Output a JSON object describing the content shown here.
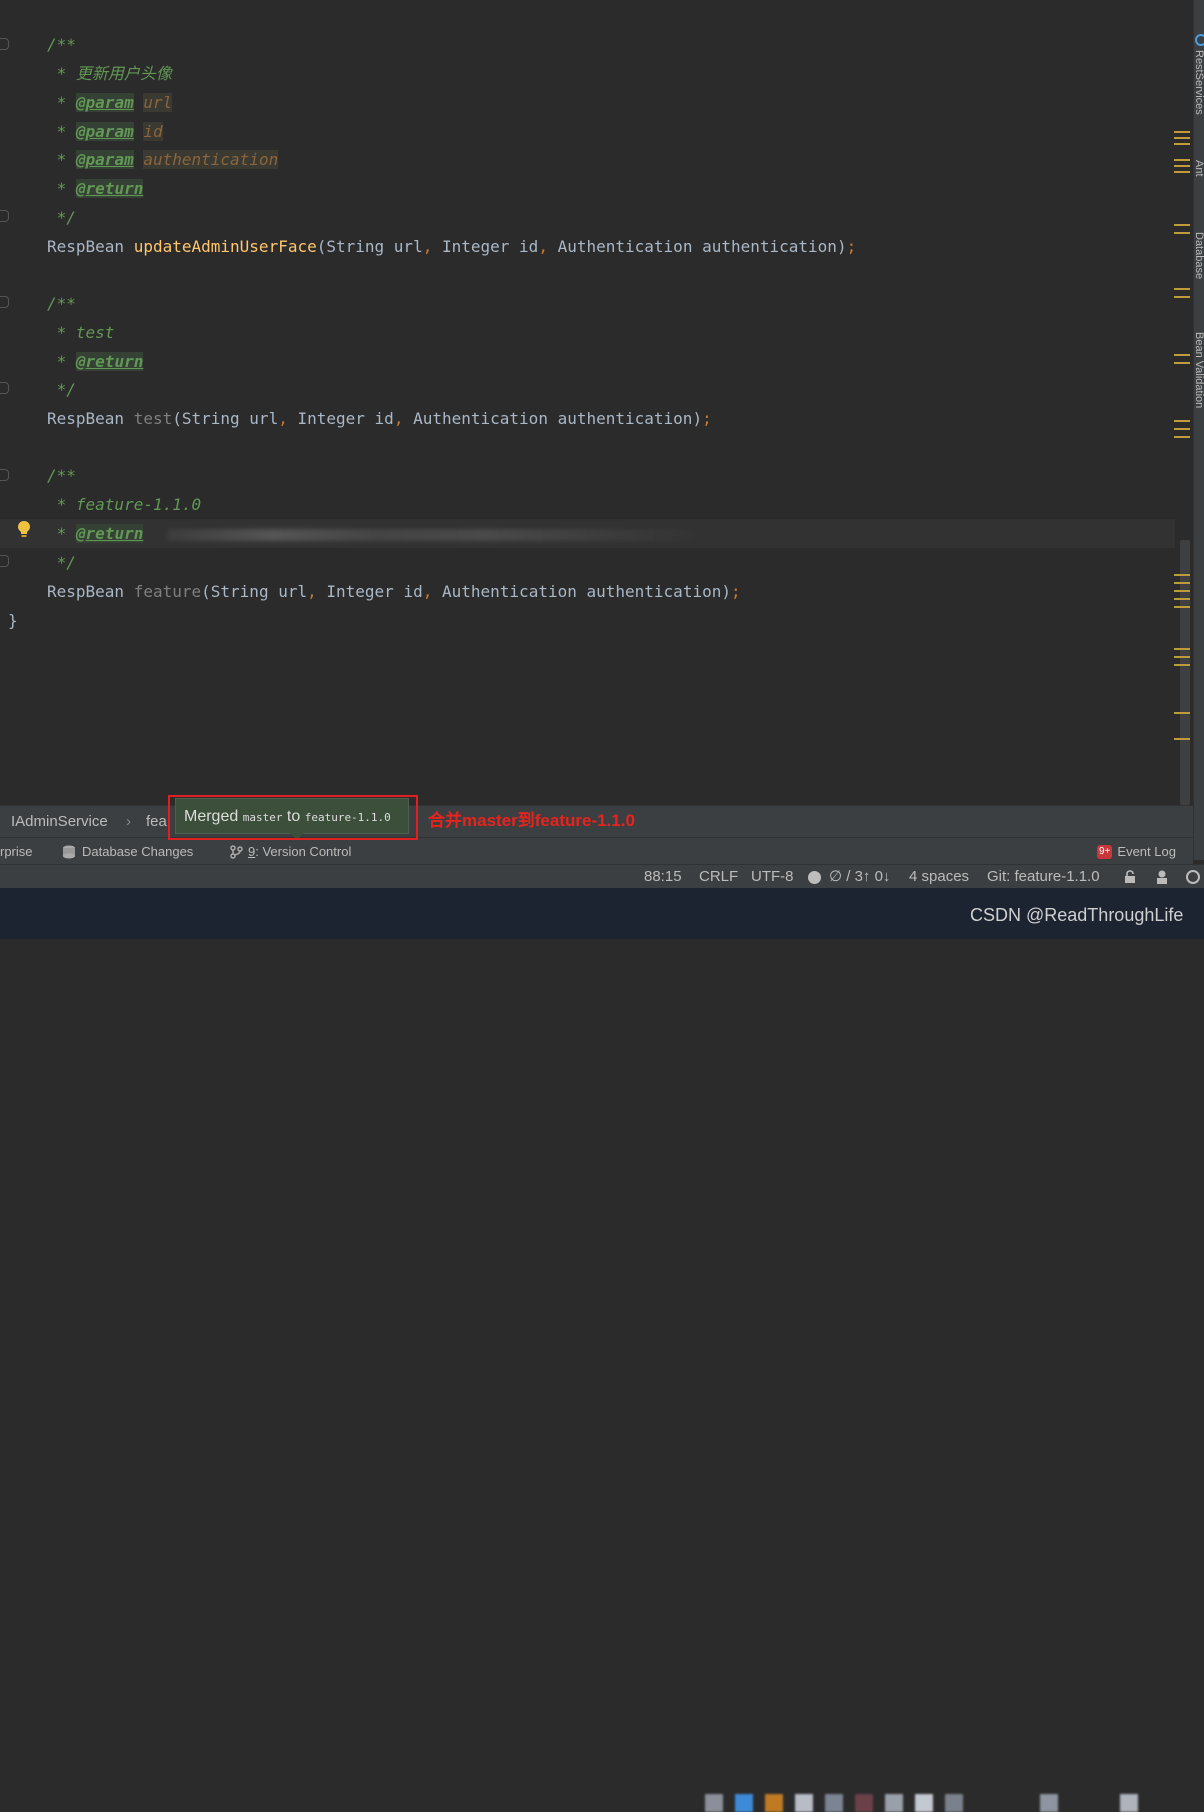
{
  "editor": {
    "doc1": {
      "open": "/**",
      "desc": " * 更新用户头像",
      "param_tag": "@param",
      "p1": "url",
      "p2": "id",
      "p3": "authentication",
      "return_tag": "@return",
      "close": " */"
    },
    "method1": {
      "ret": "RespBean ",
      "name": "updateAdminUserFace",
      "args_a": "(String url",
      "args_b": " Integer id",
      "args_c": " Authentication authentication)",
      "semi": ";"
    },
    "doc2": {
      "open": "/**",
      "desc": " * test",
      "return_tag": "@return",
      "close": " */"
    },
    "method2": {
      "ret": "RespBean ",
      "name": "test",
      "args_a": "(String url",
      "args_b": " Integer id",
      "args_c": " Authentication authentication)",
      "semi": ";"
    },
    "doc3": {
      "open": "/**",
      "desc": " * feature-1.1.0",
      "return_tag": "@return",
      "close": " */"
    },
    "method3": {
      "ret": "RespBean ",
      "name": "feature",
      "args_a": "(String url",
      "args_b": " Integer id",
      "args_c": " Authentication authentication)",
      "semi": ";"
    },
    "closing_brace": "}",
    "comma": ",",
    "star": " * "
  },
  "breadcrumbs": {
    "item1": "IAdminService",
    "item2": "fea"
  },
  "popup": {
    "merged": "Merged",
    "source_branch": "master",
    "to": "to",
    "target_branch": "feature-1.1.0"
  },
  "annotation": "合并master到feature-1.1.0",
  "tool_windows": {
    "partial": "rprise",
    "database_changes": "Database Changes",
    "version_control_num": "9",
    "version_control": ": Version Control",
    "event_log_badge": "9+",
    "event_log": "Event Log"
  },
  "status_bar": {
    "position": "88:15",
    "line_sep": "CRLF",
    "encoding": "UTF-8",
    "vcs_counts": "∅ / 3↑ 0↓",
    "indent": "4 spaces",
    "git_branch": "Git: feature-1.1.0"
  },
  "right_tabs": [
    "RestServices",
    "Ant",
    "Database",
    "Bean Validation"
  ],
  "watermark": "CSDN @ReadThroughLife",
  "colors": {
    "editor_bg": "#2b2b2b",
    "doc_comment": "#629755",
    "keyword_orange": "#cc7832",
    "method_yellow": "#ffc66d",
    "annotation_red": "#e8231d",
    "popup_green": "#3b4f3b"
  }
}
